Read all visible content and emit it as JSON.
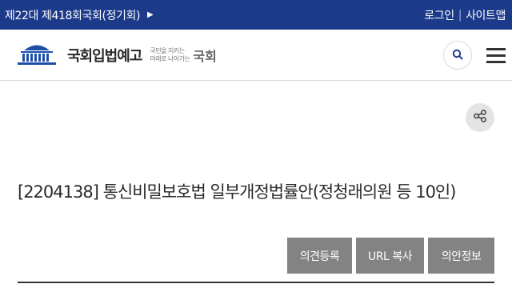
{
  "topbar": {
    "session": "제22대 제418회국회(정기회)",
    "session_arrow_icon": "triangle-right-icon",
    "login": "로그인",
    "separator": "|",
    "sitemap": "사이트맵",
    "bg_color": "#1c3a8a"
  },
  "header": {
    "logo_icon": "national-assembly-building-icon",
    "logo_title": "국회입법예고",
    "slogan_line1": "국민을 지키는",
    "slogan_line2": "미래로 나아가는",
    "slogan_big": "국회",
    "search_icon": "search-icon",
    "menu_icon": "hamburger-menu-icon"
  },
  "share": {
    "icon": "share-icon"
  },
  "bill": {
    "title": "[2204138] 통신비밀보호법 일부개정법률안(정청래의원 등 10인)"
  },
  "actions": {
    "opinion": "의견등록",
    "url_copy": "URL 복사",
    "bill_info": "의안정보",
    "button_color": "#838383"
  }
}
